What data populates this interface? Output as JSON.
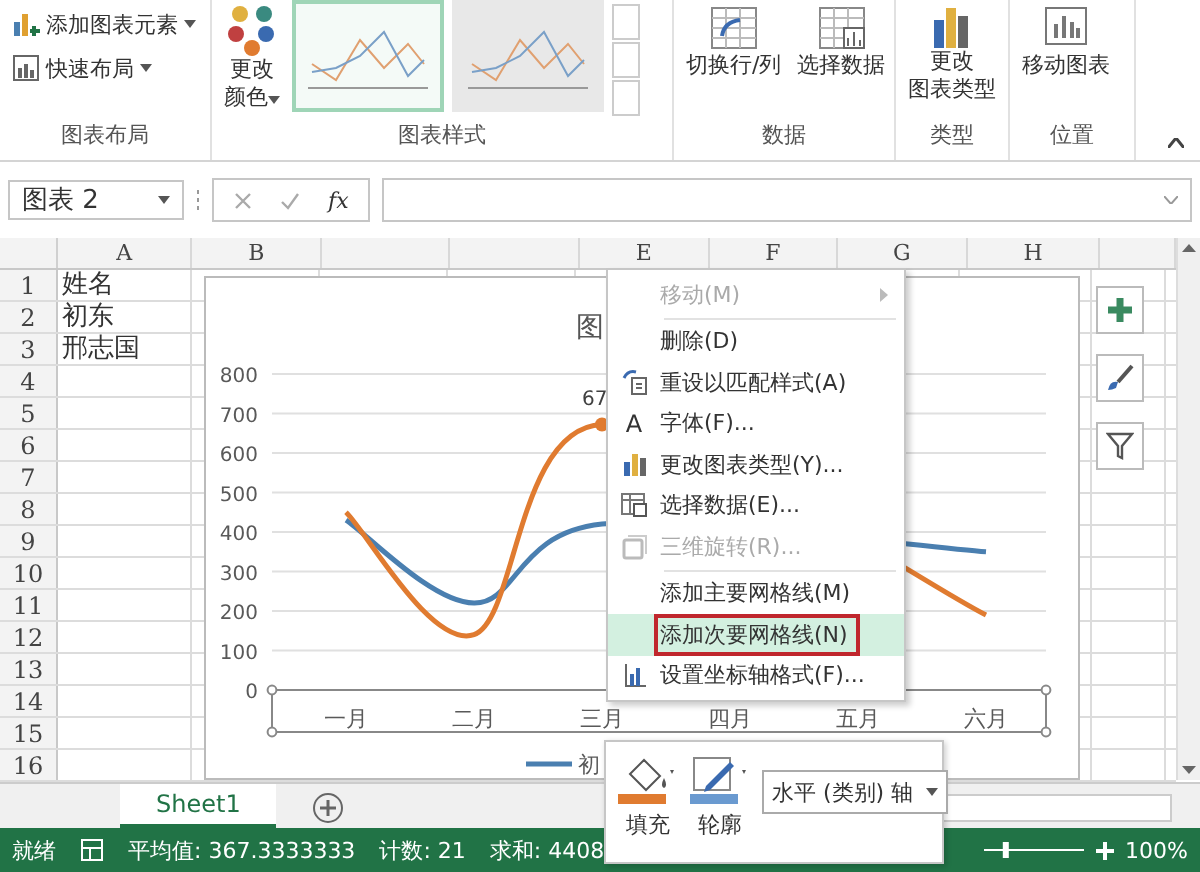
{
  "ribbon": {
    "layout_group": {
      "label": "图表布局",
      "items": [
        "添加图表元素",
        "快速布局"
      ]
    },
    "colors_button": [
      "更改",
      "颜色"
    ],
    "styles_group": {
      "label": "图表样式",
      "thumbnails": [
        {
          "selected": true
        },
        {
          "selected": false
        }
      ]
    },
    "data_group": {
      "label": "数据",
      "buttons": [
        "切换行/列",
        "选择数据"
      ]
    },
    "type_group": {
      "label": "类型",
      "button": [
        "更改",
        "图表类型"
      ]
    },
    "location_group": {
      "label": "位置",
      "button": "移动图表"
    }
  },
  "formula_bar": {
    "name_box": "图表 2",
    "fx": "fx"
  },
  "columns": [
    {
      "label": "A"
    },
    {
      "label": "B"
    },
    {},
    {},
    {
      "label": "E"
    },
    {
      "label": "F"
    },
    {
      "label": "G"
    },
    {
      "label": "H"
    },
    {}
  ],
  "rows": [
    {
      "number": "1",
      "cell_a": "姓名"
    },
    {
      "number": "2",
      "cell_a": "初东"
    },
    {
      "number": "3",
      "cell_a": "邢志国"
    },
    {
      "number": "4"
    },
    {
      "number": "5"
    },
    {
      "number": "6"
    },
    {
      "number": "7"
    },
    {
      "number": "8"
    },
    {
      "number": "9"
    },
    {
      "number": "10"
    },
    {
      "number": "11"
    },
    {
      "number": "12"
    },
    {
      "number": "13"
    },
    {
      "number": "14"
    },
    {
      "number": "15"
    },
    {
      "number": "16"
    }
  ],
  "chart": {
    "title": "图",
    "legend": "初",
    "chart_data": {
      "type": "line",
      "grid": true,
      "categories": [
        "一月",
        "二月",
        "三月",
        "四月",
        "五月",
        "六月"
      ],
      "ylim": [
        0,
        800
      ],
      "yticks": [
        0,
        100,
        200,
        300,
        400,
        500,
        600,
        700,
        800
      ],
      "series": [
        {
          "color": "#4a7fb0",
          "values": [
            430,
            220,
            420,
            null,
            null,
            350
          ]
        },
        {
          "color": "#e07b30",
          "values": [
            450,
            140,
            672,
            null,
            null,
            190
          ]
        }
      ],
      "annotations": [
        {
          "x": "三月",
          "y": 672,
          "text": "67"
        }
      ]
    }
  },
  "chart_buttons": [
    {
      "kind": "plus"
    },
    {
      "kind": "brush"
    },
    {
      "kind": "filter"
    }
  ],
  "context_menu": [
    {
      "kind": "item",
      "label": "移动(M)",
      "disabled": true,
      "submenu": true,
      "selected": false
    },
    {
      "kind": "separator"
    },
    {
      "kind": "item",
      "label": "删除(D)",
      "disabled": false,
      "submenu": false,
      "selected": false
    },
    {
      "kind": "item",
      "label": "重设以匹配样式(A)",
      "disabled": false,
      "submenu": false,
      "selected": false
    },
    {
      "kind": "item",
      "label": "字体(F)...",
      "glyph": "A",
      "disabled": false,
      "submenu": false,
      "selected": false
    },
    {
      "kind": "item",
      "label": "更改图表类型(Y)...",
      "disabled": false,
      "submenu": false,
      "selected": false
    },
    {
      "kind": "item",
      "label": "选择数据(E)...",
      "disabled": false,
      "submenu": false,
      "selected": false
    },
    {
      "kind": "item",
      "label": "三维旋转(R)...",
      "disabled": true,
      "submenu": false,
      "selected": false
    },
    {
      "kind": "separator"
    },
    {
      "kind": "item",
      "label": "添加主要网格线(M)",
      "disabled": false,
      "submenu": false,
      "selected": false
    },
    {
      "kind": "item",
      "label": "添加次要网格线(N)",
      "disabled": false,
      "submenu": false,
      "selected": true
    },
    {
      "kind": "item",
      "label": "设置坐标轴格式(F)...",
      "disabled": false,
      "submenu": false,
      "selected": false
    }
  ],
  "mini_toolbar": {
    "fill": "填充",
    "outline": "轮廓",
    "dropdown": "水平 (类别) 轴"
  },
  "sheet_tabs": [
    {
      "label": "Sheet1",
      "selected": true
    }
  ],
  "status_bar": {
    "state": "就绪",
    "stats": [
      "平均值: 367.3333333",
      "计数: 21",
      "求和: 4408"
    ],
    "zoom": "100%",
    "zoom_slider": {
      "level": 0.2
    }
  }
}
